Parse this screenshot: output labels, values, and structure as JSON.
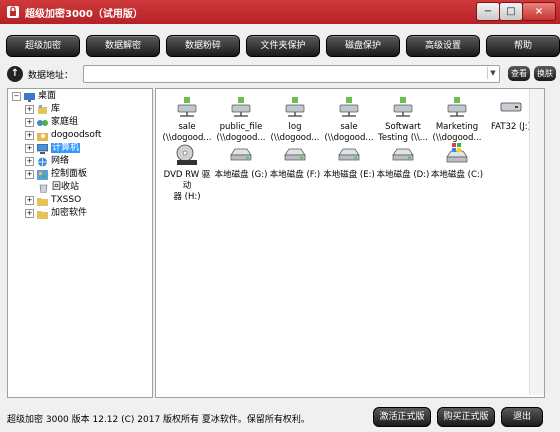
{
  "window": {
    "title": "超级加密3000（试用版）",
    "minimize": "−",
    "restore": "□",
    "close": "×"
  },
  "toolbar": [
    "超级加密",
    "数据解密",
    "数据粉碎",
    "文件夹保护",
    "磁盘保护",
    "高级设置",
    "帮助"
  ],
  "address": {
    "label": "数据地址：",
    "value": "",
    "view_button": "查看",
    "skin_button": "换肤"
  },
  "tree": [
    {
      "label": "桌面",
      "expander": "−"
    },
    {
      "label": "库",
      "expander": "+"
    },
    {
      "label": "家庭组",
      "expander": "+"
    },
    {
      "label": "dogoodsoft",
      "expander": "+"
    },
    {
      "label": "计算机",
      "expander": "+"
    },
    {
      "label": "网络",
      "expander": "+"
    },
    {
      "label": "控制面板",
      "expander": "+"
    },
    {
      "label": "回收站",
      "expander": ""
    },
    {
      "label": "TXSSO",
      "expander": "+"
    },
    {
      "label": "加密软件",
      "expander": "+"
    }
  ],
  "files": [
    {
      "line1": "sale",
      "line2": "(\\\\dogood...",
      "icon": "network-drive-icon"
    },
    {
      "line1": "public_file",
      "line2": "(\\\\dogood...",
      "icon": "network-drive-icon"
    },
    {
      "line1": "log",
      "line2": "(\\\\dogood...",
      "icon": "network-drive-icon"
    },
    {
      "line1": "sale",
      "line2": "(\\\\dogood...",
      "icon": "network-drive-icon"
    },
    {
      "line1": "Softwart",
      "line2": "Testing (\\\\...",
      "icon": "network-drive-icon"
    },
    {
      "line1": "Marketing",
      "line2": "(\\\\dogood...",
      "icon": "network-drive-icon"
    },
    {
      "line1": "FAT32 (J:)",
      "line2": "",
      "icon": "removable-drive-icon"
    },
    {
      "line1": "DVD RW 驱动",
      "line2": "器 (H:)",
      "icon": "dvd-drive-icon"
    },
    {
      "line1": "本地磁盘 (G:)",
      "line2": "",
      "icon": "local-disk-icon"
    },
    {
      "line1": "本地磁盘 (F:)",
      "line2": "",
      "icon": "local-disk-icon"
    },
    {
      "line1": "本地磁盘 (E:)",
      "line2": "",
      "icon": "local-disk-icon"
    },
    {
      "line1": "本地磁盘 (D:)",
      "line2": "",
      "icon": "local-disk-icon"
    },
    {
      "line1": "本地磁盘 (C:)",
      "line2": "",
      "icon": "system-disk-icon"
    }
  ],
  "status": {
    "text": "超级加密 3000  版本 12.12  (C)  2017 版权所有 夏冰软件。保留所有权利。"
  },
  "bottom_buttons": {
    "activate": "激活正式版",
    "buy": "购买正式版",
    "exit": "退出"
  },
  "colors": {
    "title_bar": "#c12c30",
    "button_dark": "#2a2a2a",
    "selection": "#3399ff"
  }
}
